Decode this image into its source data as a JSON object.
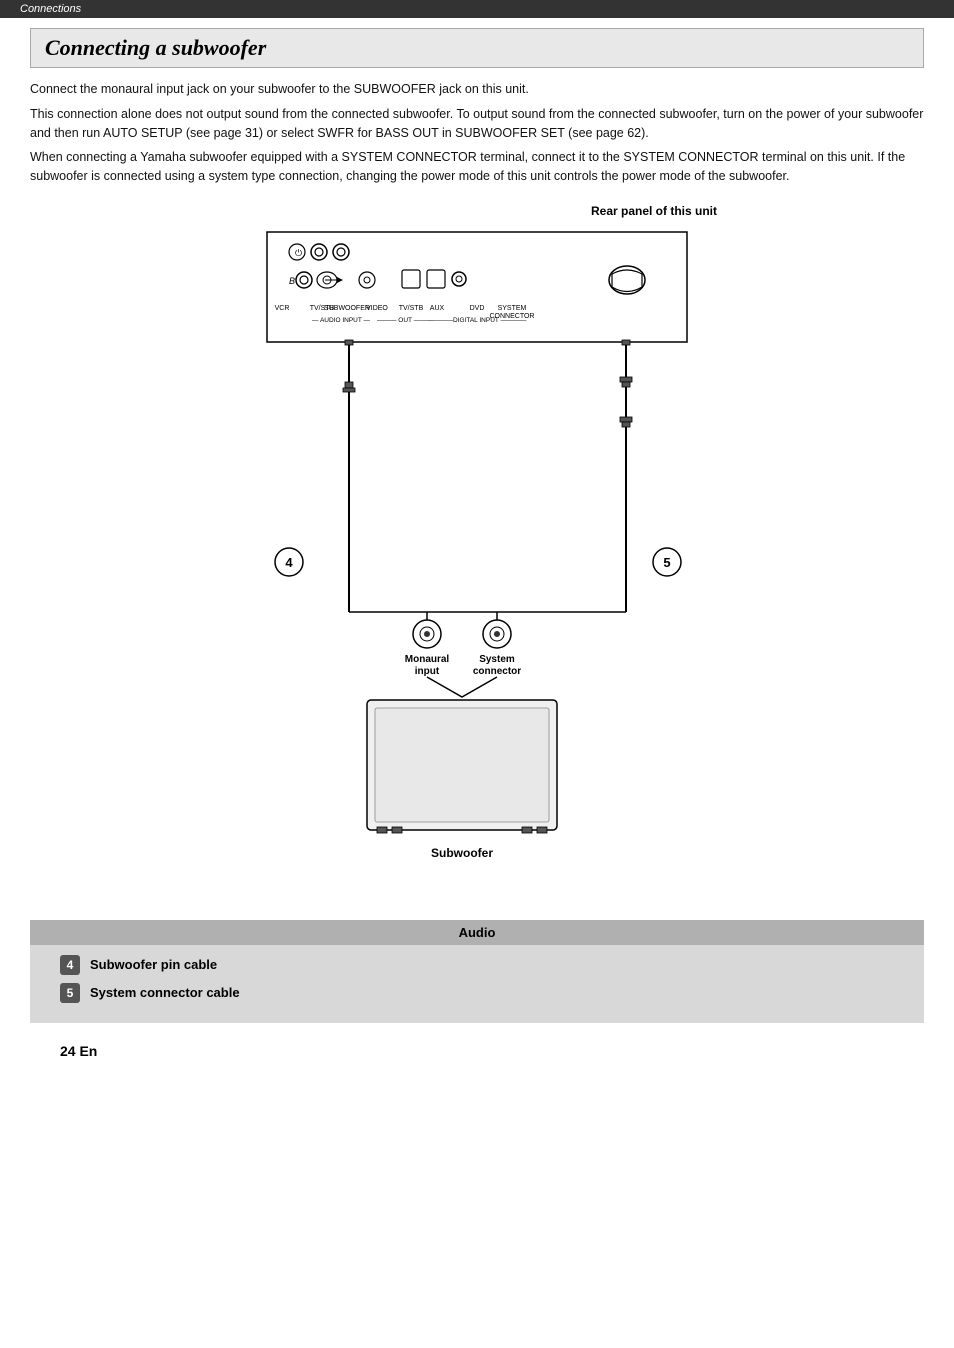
{
  "topbar": {
    "label": "Connections"
  },
  "section": {
    "title": "Connecting a subwoofer"
  },
  "body_paragraphs": [
    "Connect the monaural input jack on your subwoofer to the SUBWOOFER jack on this unit.",
    "This connection alone does not output sound from the connected subwoofer. To output sound from the connected subwoofer, turn on the power of your subwoofer and then run AUTO SETUP (see page 31) or select SWFR for BASS OUT in SUBWOOFER SET (see page 62).",
    "When connecting a Yamaha subwoofer equipped with a SYSTEM CONNECTOR terminal, connect it to the SYSTEM CONNECTOR terminal on this unit. If the subwoofer is connected using a system type connection, changing the power mode of this unit controls the power mode of the subwoofer."
  ],
  "diagram": {
    "rear_panel_label": "Rear panel of this unit",
    "labels": {
      "monaural_input": "Monaural\ninput",
      "system_connector": "System\nconnector",
      "subwoofer": "Subwoofer"
    },
    "cable_labels": {
      "4": "4",
      "5": "5"
    }
  },
  "legend": {
    "title": "Audio",
    "items": [
      {
        "num": "4",
        "text": "Subwoofer pin cable"
      },
      {
        "num": "5",
        "text": "System connector cable"
      }
    ]
  },
  "page_number": "24 En"
}
